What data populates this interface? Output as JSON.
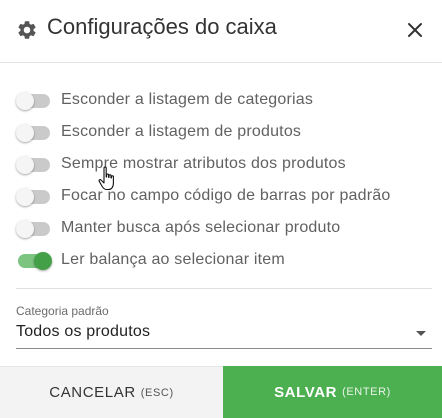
{
  "header": {
    "title": "Configurações do caixa",
    "icon": "gear-icon",
    "close_icon": "close-icon"
  },
  "options": [
    {
      "label": "Esconder a listagem de categorias",
      "enabled": false
    },
    {
      "label": "Esconder a listagem de produtos",
      "enabled": false
    },
    {
      "label": "Sempre mostrar atributos dos produtos",
      "enabled": false
    },
    {
      "label": "Focar no campo código de barras por padrão",
      "enabled": false
    },
    {
      "label": "Manter busca após selecionar produto",
      "enabled": false
    },
    {
      "label": "Ler balança ao selecionar item",
      "enabled": true
    }
  ],
  "default_category": {
    "caption": "Categoria padrão",
    "value": "Todos os produtos"
  },
  "footer": {
    "cancel_label": "CANCELAR",
    "cancel_hint": "(ESC)",
    "save_label": "SALVAR",
    "save_hint": "(ENTER)"
  },
  "colors": {
    "accent": "#4caf50",
    "switch_on": "#43a047"
  }
}
